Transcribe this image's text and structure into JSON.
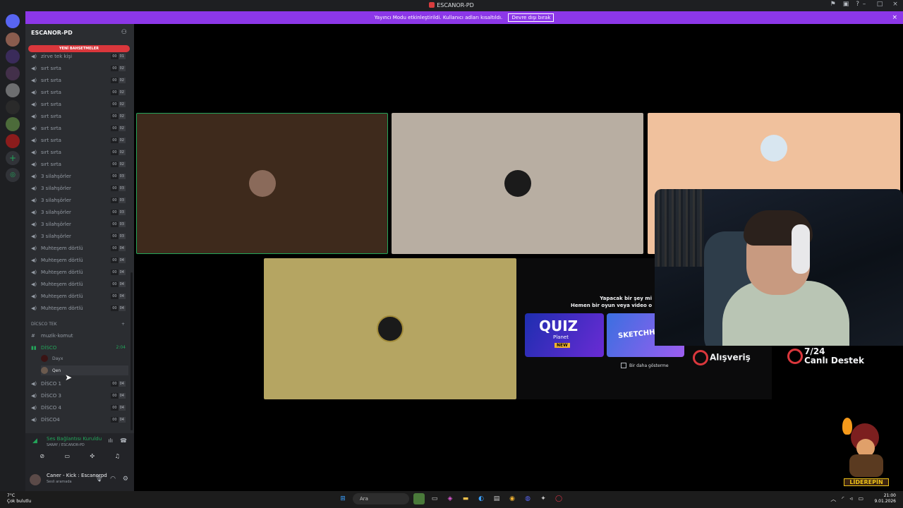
{
  "titlebar": {
    "title": "ESCANOR-PD",
    "controls": [
      "–",
      "□",
      "×"
    ],
    "tools": [
      "pin-icon",
      "inbox-icon",
      "help-icon"
    ]
  },
  "banner": {
    "text": "Yayıncı Modu etkinleştirildi. Kullanıcı adları kısaltıldı.",
    "button": "Devre dışı bırak",
    "close": "×"
  },
  "server": {
    "name": "ESCANOR-PD",
    "new_mentions": "YENİ BAHSETMELER"
  },
  "voice_channels": [
    {
      "name": "zirve tek kişi",
      "count_a": "00",
      "count_b": "01"
    },
    {
      "name": "sırt sırta",
      "count_a": "00",
      "count_b": "02"
    },
    {
      "name": "sırt sırta",
      "count_a": "00",
      "count_b": "02"
    },
    {
      "name": "sırt sırta",
      "count_a": "00",
      "count_b": "02"
    },
    {
      "name": "sırt sırta",
      "count_a": "00",
      "count_b": "02"
    },
    {
      "name": "sırt sırta",
      "count_a": "00",
      "count_b": "02"
    },
    {
      "name": "sırt sırta",
      "count_a": "00",
      "count_b": "02"
    },
    {
      "name": "sırt sırta",
      "count_a": "00",
      "count_b": "02"
    },
    {
      "name": "sırt sırta",
      "count_a": "00",
      "count_b": "02"
    },
    {
      "name": "sırt sırta",
      "count_a": "00",
      "count_b": "02"
    },
    {
      "name": "3 silahşörler",
      "count_a": "00",
      "count_b": "03"
    },
    {
      "name": "3 silahşörler",
      "count_a": "00",
      "count_b": "03"
    },
    {
      "name": "3 silahşörler",
      "count_a": "00",
      "count_b": "03"
    },
    {
      "name": "3 silahşörler",
      "count_a": "00",
      "count_b": "03"
    },
    {
      "name": "3 silahşörler",
      "count_a": "00",
      "count_b": "03"
    },
    {
      "name": "3 silahşörler",
      "count_a": "00",
      "count_b": "03"
    },
    {
      "name": "Muhteşem dörtlü",
      "count_a": "00",
      "count_b": "04"
    },
    {
      "name": "Muhteşem dörtlü",
      "count_a": "00",
      "count_b": "04"
    },
    {
      "name": "Muhteşem dörtlü",
      "count_a": "00",
      "count_b": "04"
    },
    {
      "name": "Muhteşem dörtlü",
      "count_a": "00",
      "count_b": "04"
    },
    {
      "name": "Muhteşem dörtlü",
      "count_a": "00",
      "count_b": "04"
    },
    {
      "name": "Muhteşem dörtlü",
      "count_a": "00",
      "count_b": "04"
    }
  ],
  "category": {
    "name": "DİCSCO TEK",
    "add": "+"
  },
  "text_channel": {
    "name": "muzik-komut"
  },
  "active_channel": {
    "name": "DİSCO",
    "timer": "2:04",
    "members": [
      "Dayx",
      "Qen"
    ]
  },
  "other_channels": [
    {
      "name": "DİSCO 1",
      "count_a": "00",
      "count_b": "04"
    },
    {
      "name": "DİSCO 3",
      "count_a": "00",
      "count_b": "04"
    },
    {
      "name": "DİSCO 4",
      "count_a": "00",
      "count_b": "04"
    },
    {
      "name": "DİSCO4",
      "count_a": "00",
      "count_b": "04"
    }
  ],
  "voice_panel": {
    "status": "Ses Bağlantısı Kuruldu",
    "sub": "SARAY / ESCANOR-PD"
  },
  "user": {
    "name": "Caner - Kick : Escanorpd",
    "status": "Sesli aramada"
  },
  "promo": {
    "title_line1": "Yapacak bir şey mi",
    "title_line2": "Hemen bir oyun veya video o",
    "quiz_title": "QUIZ",
    "quiz_sub": "Planet",
    "quiz_badge": "NEW",
    "sketch_title": "SKETCHHe",
    "checkbox_label": "Bir daha gösterme"
  },
  "overlay": {
    "ad_shopping": "Alışveriş",
    "ad_support_line1": "7/24",
    "ad_support_line2": "Canlı Destek",
    "logo_text": "LİDEREPİN"
  },
  "taskbar": {
    "weather_temp": "7°C",
    "weather_text": "Çok bulutlu",
    "search": "Ara",
    "time": "21:00",
    "date": "9.01.2026"
  },
  "colors": {
    "accent": "#5865f2",
    "banner": "#8c37e8",
    "online": "#23a55a",
    "mention": "#da373c"
  }
}
